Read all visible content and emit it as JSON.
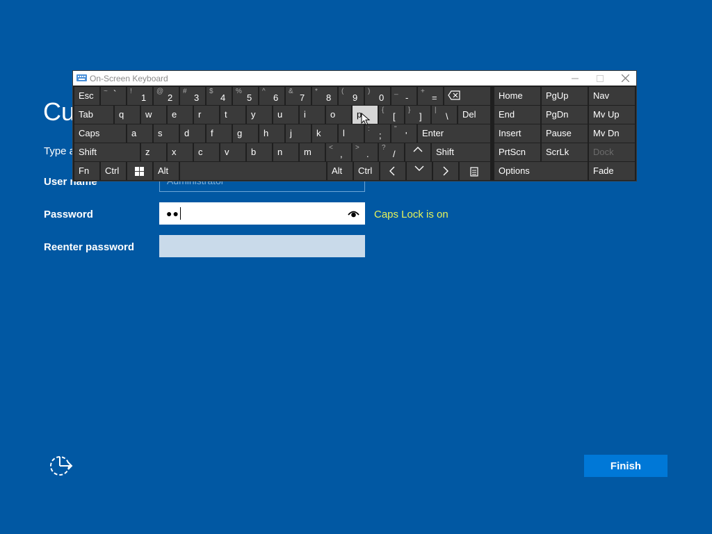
{
  "page": {
    "title": "Cu",
    "subtitle": "Type a",
    "labels": {
      "user_name": "User name",
      "password": "Password",
      "reenter_password": "Reenter password"
    },
    "user_name_placeholder": "Administrator",
    "password_dots": "●●",
    "caps_lock_warning": "Caps Lock is on",
    "finish_label": "Finish"
  },
  "osk": {
    "title": "On-Screen Keyboard",
    "row1": {
      "esc": "Esc",
      "keys": [
        {
          "s": "~",
          "m": "`"
        },
        {
          "s": "!",
          "m": "1"
        },
        {
          "s": "@",
          "m": "2"
        },
        {
          "s": "#",
          "m": "3"
        },
        {
          "s": "$",
          "m": "4"
        },
        {
          "s": "%",
          "m": "5"
        },
        {
          "s": "^",
          "m": "6"
        },
        {
          "s": "&",
          "m": "7"
        },
        {
          "s": "*",
          "m": "8"
        },
        {
          "s": "(",
          "m": "9"
        },
        {
          "s": ")",
          "m": "0"
        },
        {
          "s": "_",
          "m": "-"
        },
        {
          "s": "+",
          "m": "="
        }
      ]
    },
    "row2": {
      "tab": "Tab",
      "letters": [
        "q",
        "w",
        "e",
        "r",
        "t",
        "y",
        "u",
        "i",
        "o",
        "p"
      ],
      "brackets": [
        {
          "s": "{",
          "m": "["
        },
        {
          "s": "}",
          "m": "]"
        },
        {
          "s": "|",
          "m": "\\"
        }
      ],
      "del": "Del"
    },
    "row3": {
      "caps": "Caps",
      "letters": [
        "a",
        "s",
        "d",
        "f",
        "g",
        "h",
        "j",
        "k",
        "l"
      ],
      "punct": [
        {
          "s": ":",
          "m": ";"
        },
        {
          "s": "\"",
          "m": "'"
        }
      ],
      "enter": "Enter"
    },
    "row4": {
      "shift": "Shift",
      "letters": [
        "z",
        "x",
        "c",
        "v",
        "b",
        "n",
        "m"
      ],
      "punct": [
        {
          "s": "<",
          "m": ","
        },
        {
          "s": ">",
          "m": "."
        },
        {
          "s": "?",
          "m": "/"
        }
      ],
      "shift_right": "Shift"
    },
    "row5": {
      "fn": "Fn",
      "ctrl": "Ctrl",
      "alt": "Alt",
      "alt_right": "Alt",
      "ctrl_right": "Ctrl"
    },
    "nav": {
      "home": "Home",
      "pgup": "PgUp",
      "nav": "Nav",
      "end": "End",
      "pgdn": "PgDn",
      "mvup": "Mv Up",
      "insert": "Insert",
      "pause": "Pause",
      "mvdn": "Mv Dn",
      "prtscn": "PrtScn",
      "scrlk": "ScrLk",
      "dock": "Dock",
      "options": "Options",
      "fade": "Fade"
    },
    "hovered_key": "p"
  },
  "colors": {
    "background": "#0158a3",
    "key": "#3a3a3a",
    "key_hover": "#d6d6d6",
    "caps_warning": "#e6f25a",
    "finish_button": "#0078d7"
  }
}
